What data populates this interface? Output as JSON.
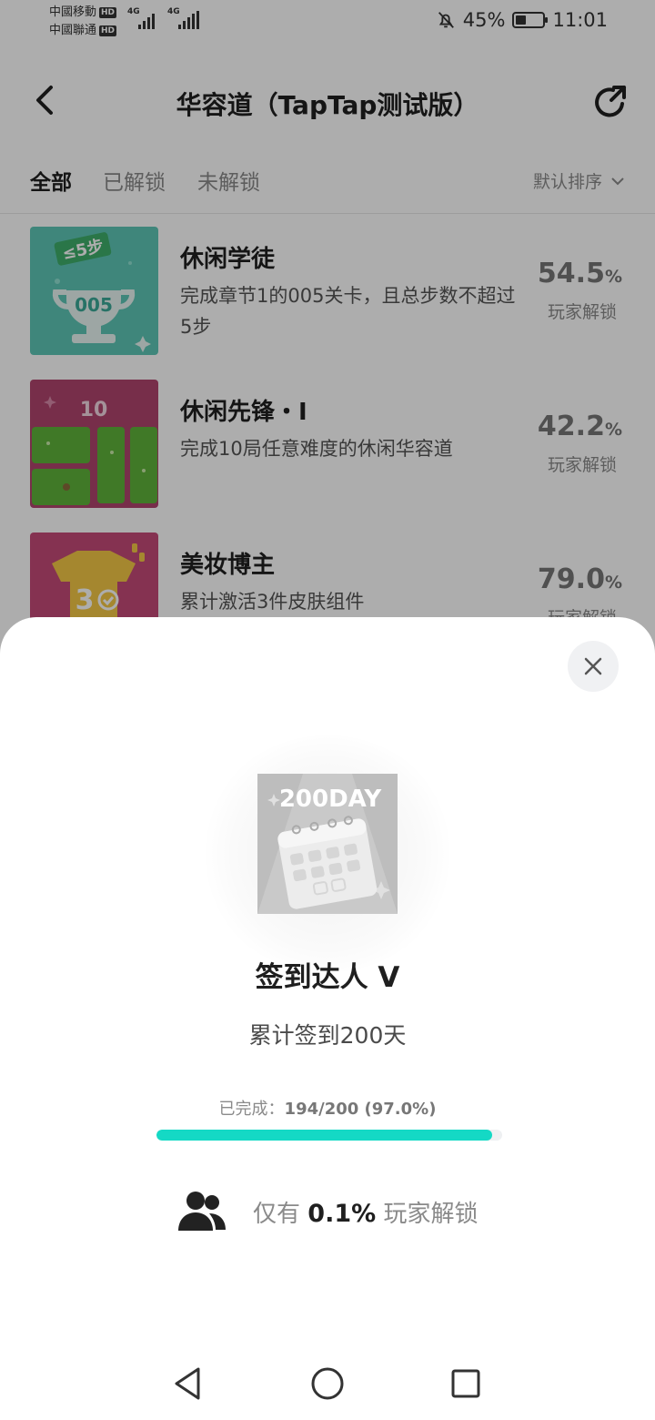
{
  "status_bar": {
    "carrier1": "中國移動",
    "carrier2": "中國聯通",
    "hd_label": "HD",
    "network_label": "4G",
    "battery_percent": "45%",
    "battery_level": 0.45,
    "time": "11:01"
  },
  "header": {
    "title": "华容道（TapTap测试版）"
  },
  "tabs": {
    "all": "全部",
    "unlocked": "已解锁",
    "locked": "未解锁",
    "sort_label": "默认排序"
  },
  "achievements": [
    {
      "title": "休闲学徒",
      "desc": "完成章节1的005关卡，且总步数不超过5步",
      "percent": "54.5",
      "percent_unit": "%",
      "sub": "玩家解锁",
      "badge_text": "≤5步",
      "badge_num": "005"
    },
    {
      "title": "休闲先锋・Ⅰ",
      "desc": "完成10局任意难度的休闲华容道",
      "percent": "42.2",
      "percent_unit": "%",
      "sub": "玩家解锁",
      "badge_num": "10"
    },
    {
      "title": "美妆博主",
      "desc": "累计激活3件皮肤组件",
      "percent": "79.0",
      "percent_unit": "%",
      "sub": "玩家解锁",
      "badge_num": "3"
    }
  ],
  "sheet": {
    "badge_text": "200DAY",
    "title": "签到达人 V",
    "desc": "累计签到200天",
    "progress_label": "已完成：",
    "progress_value": "194/200 (97.0%)",
    "progress_fraction": 0.97,
    "rarity_prefix": "仅有",
    "rarity_value": "0.1%",
    "rarity_suffix": "玩家解锁"
  },
  "colors": {
    "accent": "#14d9c5",
    "overlay": "rgba(0,0,0,0.32)"
  },
  "icons": [
    "back-arrow-icon",
    "share-icon",
    "chevron-down-icon",
    "close-icon",
    "users-icon",
    "nav-back-icon",
    "nav-home-icon",
    "nav-recents-icon"
  ]
}
